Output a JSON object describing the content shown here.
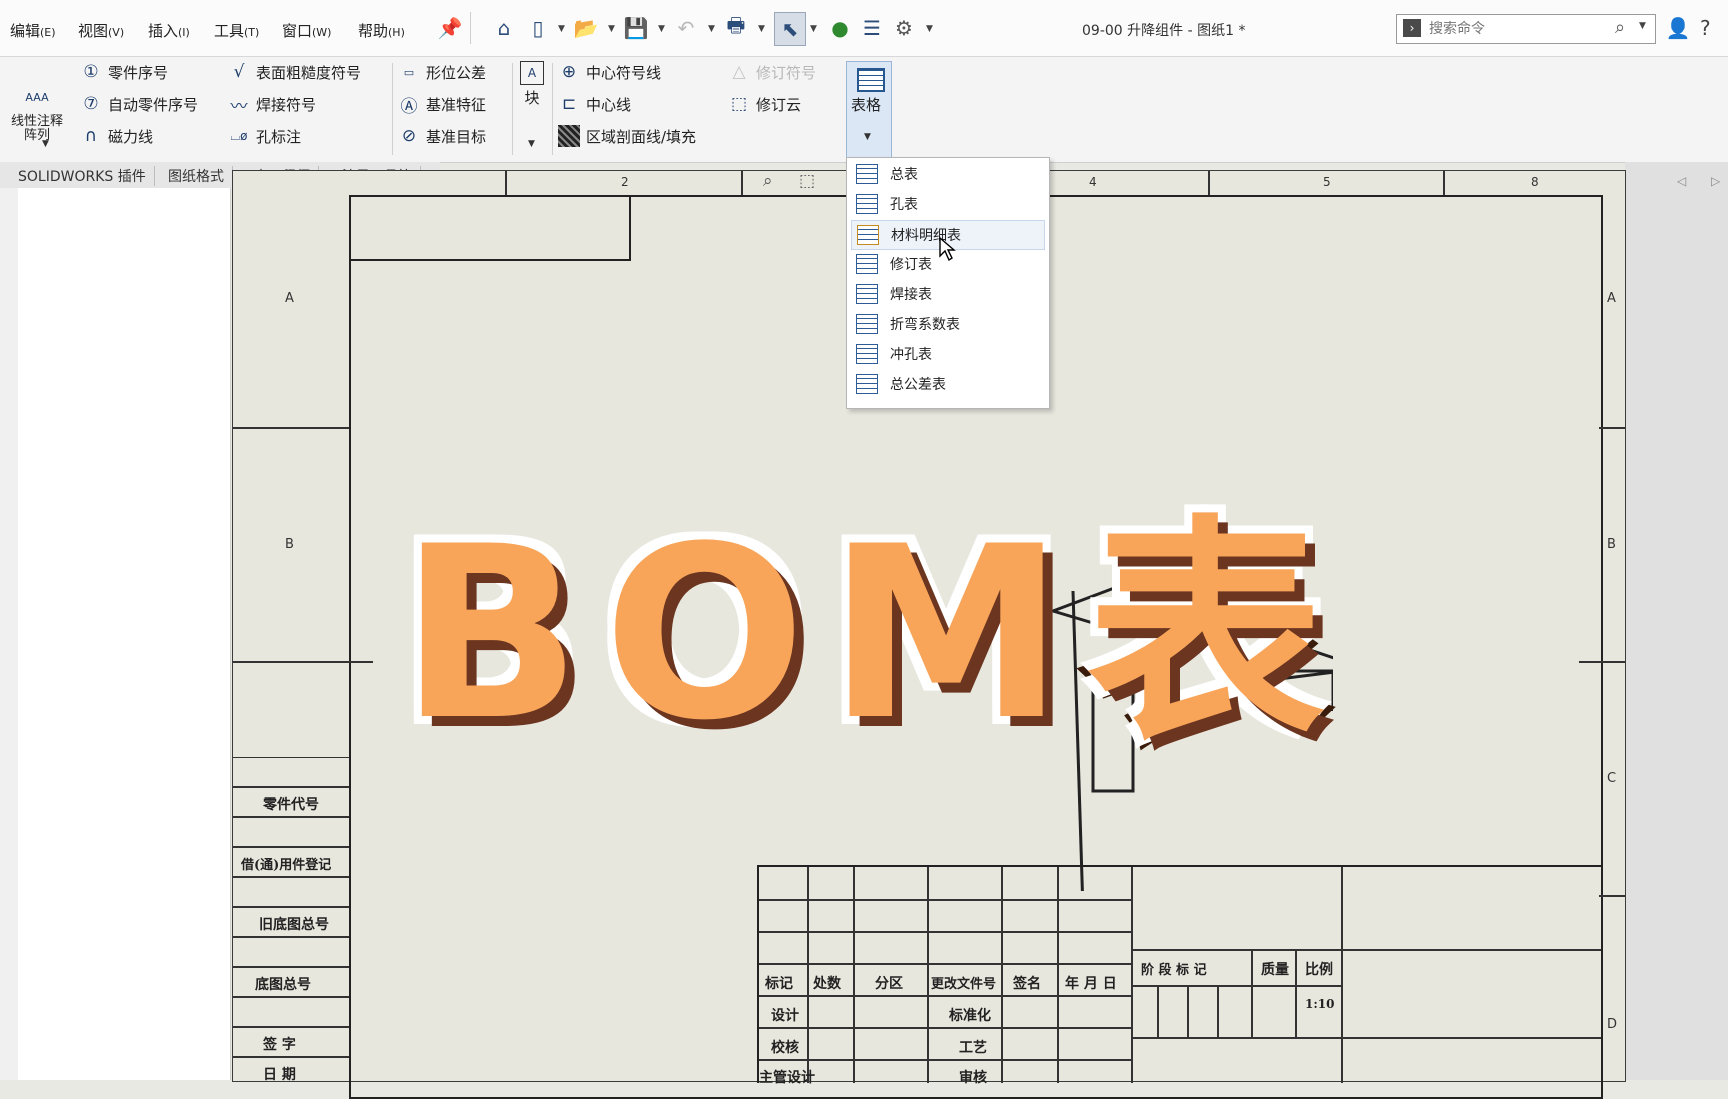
{
  "menubar": {
    "items": [
      {
        "label": "编辑",
        "key": "(E)"
      },
      {
        "label": "视图",
        "key": "(V)"
      },
      {
        "label": "插入",
        "key": "(I)"
      },
      {
        "label": "工具",
        "key": "(T)"
      },
      {
        "label": "窗口",
        "key": "(W)"
      },
      {
        "label": "帮助",
        "key": "(H)"
      }
    ],
    "doc_title": "09-00 升降组件 - 图纸1 *",
    "search_placeholder": "搜索命令",
    "help": "?"
  },
  "ribbon": {
    "col1": [
      "线性注释阵列"
    ],
    "col2": [
      "零件序号",
      "自动零件序号",
      "磁力线"
    ],
    "col3": [
      "表面粗糙度符号",
      "焊接符号",
      "孔标注"
    ],
    "col4": [
      "形位公差",
      "基准特征",
      "基准目标"
    ],
    "col5": [
      "块"
    ],
    "col6": [
      "中心符号线",
      "中心线",
      "区域剖面线/填充"
    ],
    "col7": [
      "修订符号",
      "修订云"
    ],
    "table_button": "表格"
  },
  "tabs": [
    "SOLIDWORKS 插件",
    "图纸格式",
    "大工程师",
    "沐风工具箱"
  ],
  "table_menu": {
    "items": [
      "总表",
      "孔表",
      "材料明细表",
      "修订表",
      "焊接表",
      "折弯系数表",
      "冲孔表",
      "总公差表"
    ],
    "hovered_index": 2
  },
  "sheet": {
    "column_numbers": [
      "2",
      "4",
      "5",
      "8"
    ],
    "row_zones_left": [
      "A",
      "B"
    ],
    "row_zones_right": [
      "A",
      "B",
      "C",
      "D"
    ],
    "left_block": [
      "零件代号",
      "借(通)用件登记",
      "旧底图总号",
      "底图总号",
      "签 字",
      "日 期"
    ],
    "title_block": {
      "header": [
        "标记",
        "处数",
        "分区",
        "更改文件号",
        "签名",
        "年 月 日"
      ],
      "row1": [
        "设计",
        "标准化"
      ],
      "row2": [
        "校核",
        "工艺"
      ],
      "row3": [
        "主管设计",
        "审核"
      ],
      "stage": [
        "阶 段 标 记",
        "质量",
        "比例"
      ],
      "scale": "1:10"
    }
  },
  "overlay": {
    "title": "BOM表"
  }
}
